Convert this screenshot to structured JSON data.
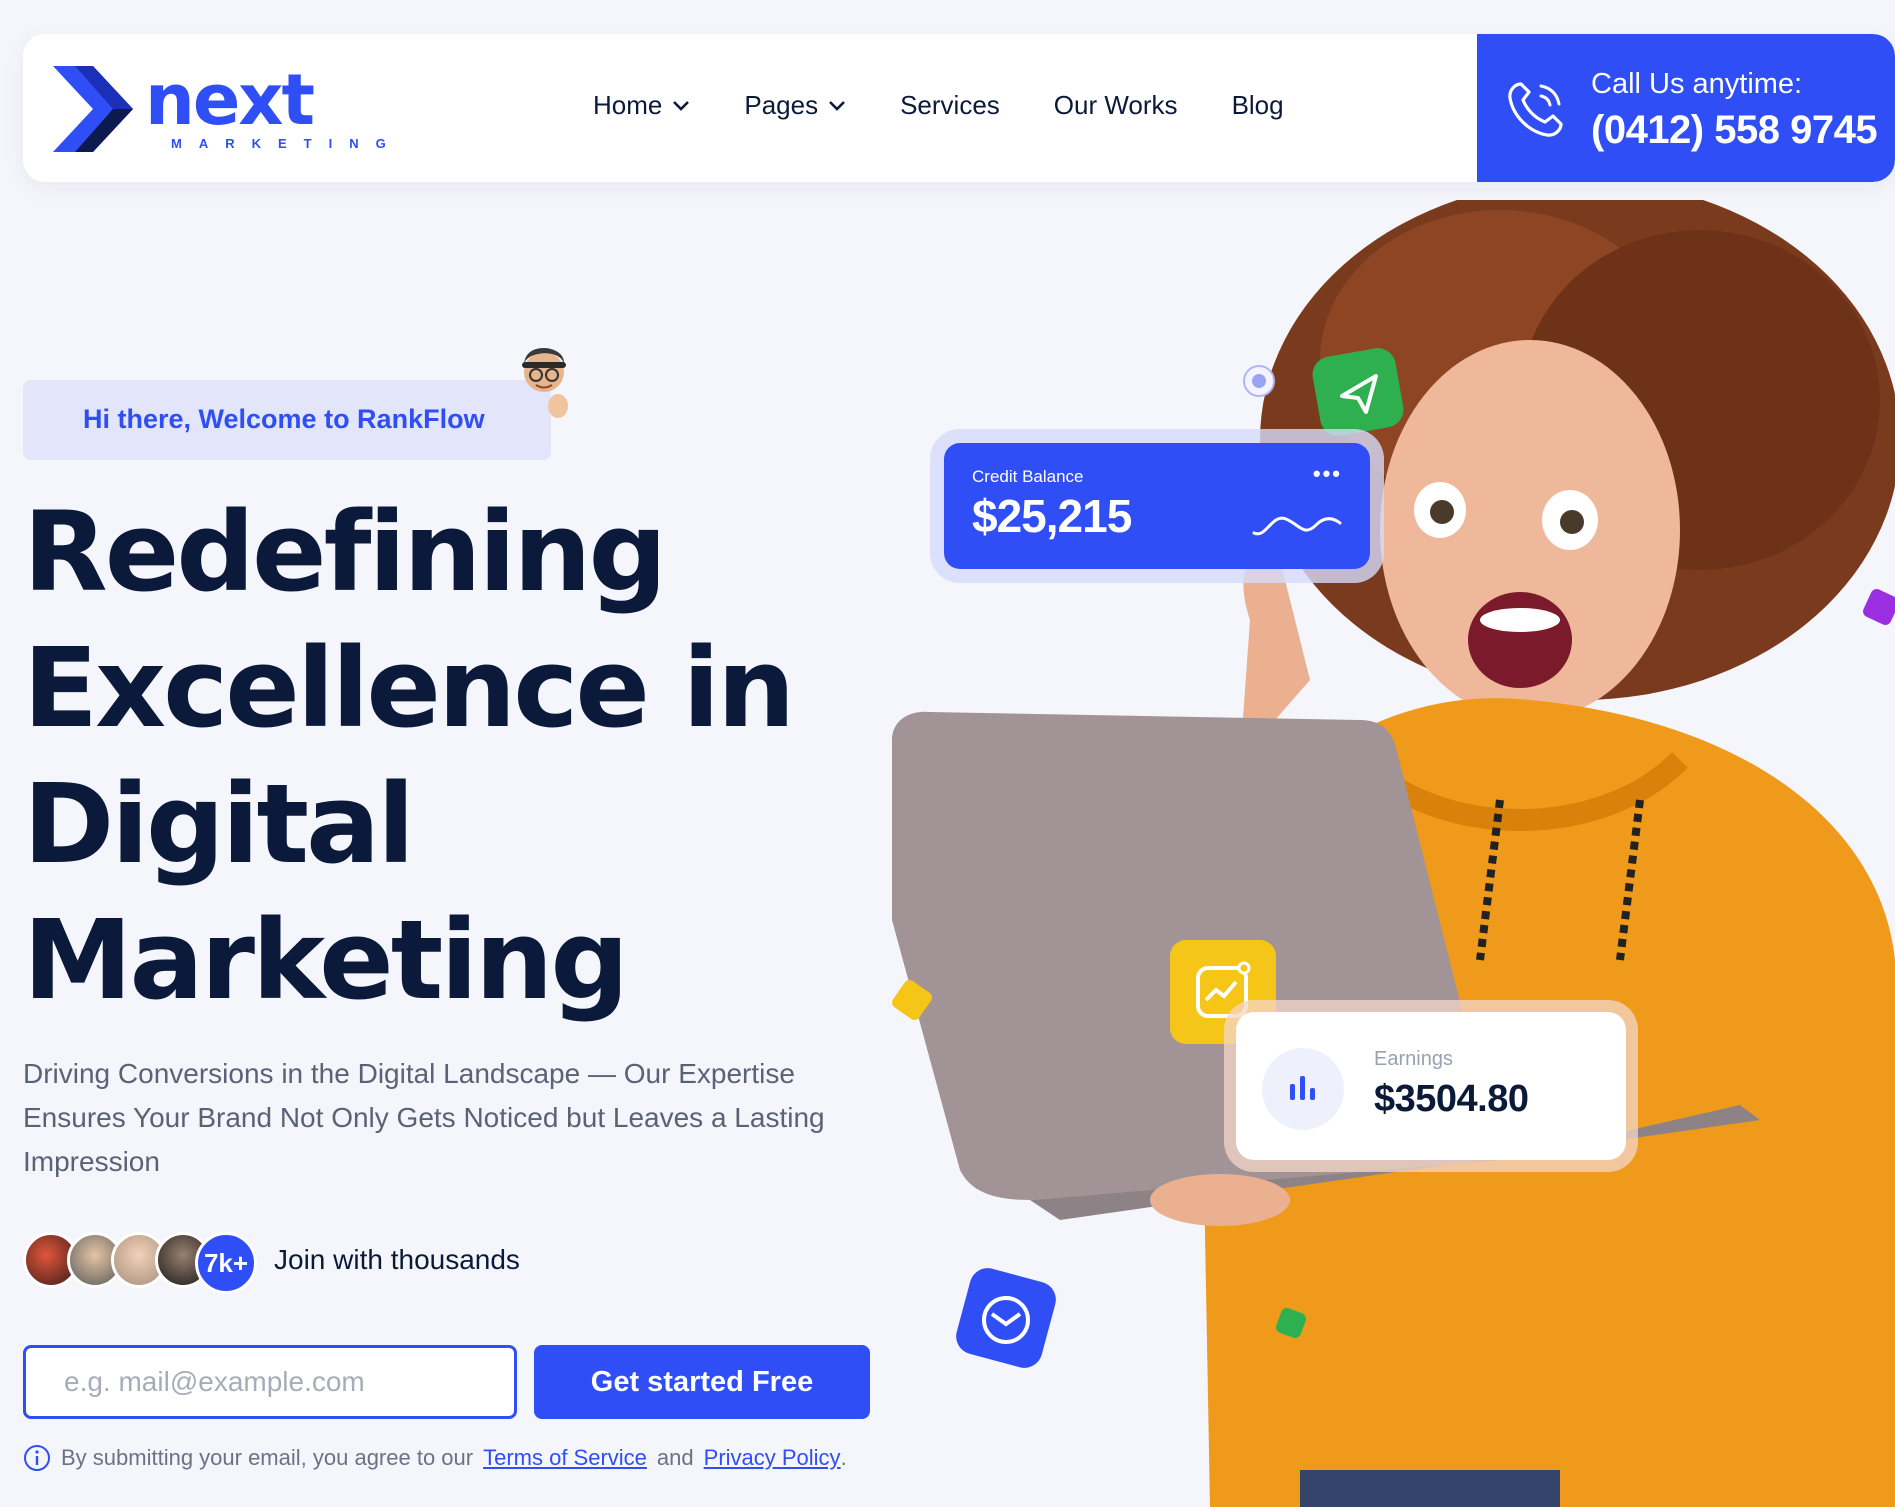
{
  "brand": {
    "name": "next",
    "tagline": "MARKETING",
    "accent": "#2f4ef5",
    "dark": "#0b1a3b"
  },
  "nav": [
    {
      "label": "Home",
      "has_dropdown": true
    },
    {
      "label": "Pages",
      "has_dropdown": true
    },
    {
      "label": "Services",
      "has_dropdown": false
    },
    {
      "label": "Our Works",
      "has_dropdown": false
    },
    {
      "label": "Blog",
      "has_dropdown": false
    }
  ],
  "call": {
    "label": "Call Us anytime:",
    "number": "(0412) 558 9745",
    "icon": "phone-icon"
  },
  "hero": {
    "welcome": "Hi there, Welcome to RankFlow",
    "headline": [
      "Redefining",
      "Excellence in",
      "Digital",
      "Marketing"
    ],
    "subtext": "Driving Conversions in the Digital Landscape — Our Expertise Ensures Your Brand Not Only Gets Noticed but Leaves a Lasting Impression",
    "join_count": "7k+",
    "join_text": "Join with thousands",
    "email_placeholder": "e.g. mail@example.com",
    "cta_label": "Get started Free",
    "consent_prefix": "By submitting your email, you agree to our",
    "terms_label": "Terms of Service",
    "consent_and": "and",
    "privacy_label": "Privacy Policy",
    "consent_suffix": "."
  },
  "cards": {
    "credit": {
      "label": "Credit Balance",
      "value": "$25,215",
      "menu": "•••"
    },
    "earnings": {
      "label": "Earnings",
      "value": "$3504.80"
    }
  }
}
